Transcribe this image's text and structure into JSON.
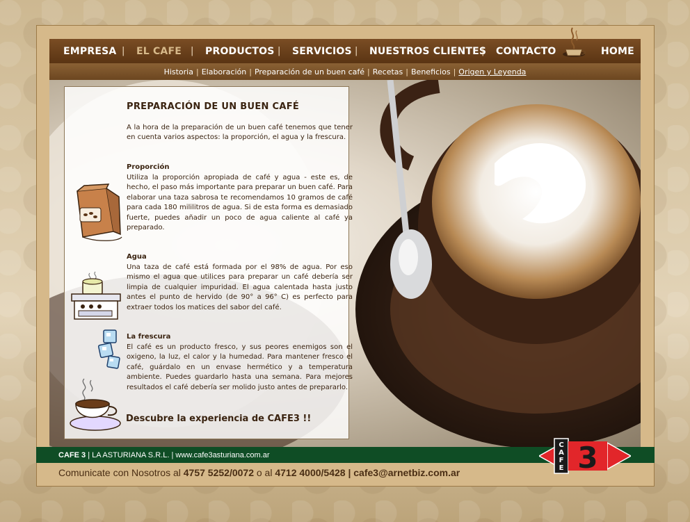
{
  "nav": {
    "items": [
      {
        "label": "EMPRESA",
        "active": false
      },
      {
        "label": "EL CAFE",
        "active": true
      },
      {
        "label": "PRODUCTOS",
        "active": false
      },
      {
        "label": "SERVICIOS",
        "active": false
      },
      {
        "label": "NUESTROS CLIENTES",
        "active": false
      },
      {
        "label": "CONTACTO",
        "active": false
      },
      {
        "label": "HOME",
        "active": false
      }
    ],
    "separator": "|"
  },
  "subnav": {
    "items": [
      {
        "label": "Historia",
        "current": false
      },
      {
        "label": "Elaboración",
        "current": false
      },
      {
        "label": "Preparación de un buen café",
        "current": false
      },
      {
        "label": "Recetas",
        "current": false
      },
      {
        "label": "Beneficios",
        "current": false
      },
      {
        "label": "Origen y Leyenda",
        "current": true
      }
    ],
    "separator": "|"
  },
  "content": {
    "title": "PREPARACIÓN DE UN BUEN CAFÉ",
    "intro": "A la hora de la preparación de un buen café tenemos que tener en cuenta varios aspectos: la proporción, el agua y la frescura.",
    "sections": [
      {
        "title": "Proporción",
        "text": "Utiliza la proporción apropiada de café y agua - este es, de hecho, el paso más importante para preparar un buen café. Para elaborar una taza sabrosa te recomendamos 10 gramos de café para cada 180 mililitros de agua. Si de esta forma es demasiado fuerte, puedes añadir un poco de agua caliente al café ya preparado.",
        "icon": "coffee-bag-icon"
      },
      {
        "title": "Agua",
        "text": "Una taza de café está formada por el 98% de agua. Por eso mismo el agua que utilices para preparar un café debería ser limpia de cualquier impuridad. El agua calentada hasta justo antes el punto de hervido (de 90° a 96° C) es perfecto para extraer todos los matices del sabor del café.",
        "icon": "stove-pot-icon"
      },
      {
        "title": "La frescura",
        "text": "El café es un producto fresco, y sus peores enemigos son el oxigeno, la luz, el calor y la humedad. Para mantener fresco el café, guárdalo en un envase hermético y a temperatura ambiente. Puedes guardarlo hasta una semana. Para mejores resultados el café debería ser molido justo antes de prepararlo.",
        "icon": "ice-cubes-icon"
      }
    ],
    "cta": "Descubre la experiencia de CAFE3 !!"
  },
  "footer": {
    "brand": "CAFE 3",
    "company": "LA ASTURIANA S.R.L.",
    "url": "www.cafe3asturiana.com.ar",
    "separator": "|",
    "contact_prefix": "Comunicate con Nosotros al",
    "phone1": "4757 5252/0072",
    "joiner": "o al",
    "phone2": "4712 4000/5428",
    "email": "cafe3@arnetbiz.com.ar"
  },
  "badge": {
    "letters": "CAFE",
    "number": "3"
  },
  "colors": {
    "nav_bg": "#5a3413",
    "nav_active": "#d7b98a",
    "footer_green": "#0f4d25",
    "badge_red": "#e2262a",
    "text_brown": "#3a2310"
  }
}
